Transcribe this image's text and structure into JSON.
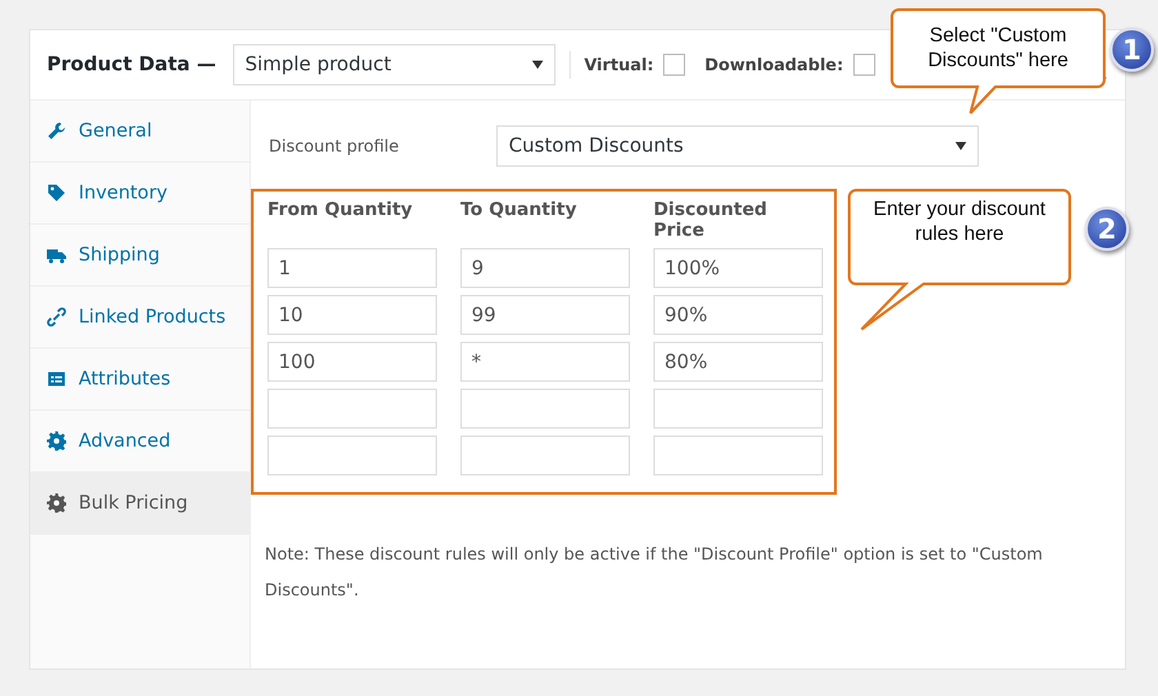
{
  "header": {
    "title": "Product Data —",
    "product_type": "Simple product",
    "options": [
      {
        "label": "Virtual:",
        "checked": false
      },
      {
        "label": "Downloadable:",
        "checked": false
      }
    ]
  },
  "sidebar": {
    "items": [
      {
        "label": "General",
        "selected": false
      },
      {
        "label": "Inventory",
        "selected": false
      },
      {
        "label": "Shipping",
        "selected": false
      },
      {
        "label": "Linked Products",
        "selected": false
      },
      {
        "label": "Attributes",
        "selected": false
      },
      {
        "label": "Advanced",
        "selected": false
      },
      {
        "label": "Bulk Pricing",
        "selected": true
      }
    ]
  },
  "discount_profile": {
    "label": "Discount profile",
    "value": "Custom Discounts"
  },
  "rules": {
    "columns": [
      "From Quantity",
      "To Quantity",
      "Discounted Price"
    ],
    "rows": [
      {
        "values": [
          "1",
          "9",
          "100%"
        ]
      },
      {
        "values": [
          "10",
          "99",
          "90%"
        ]
      },
      {
        "values": [
          "100",
          "*",
          "80%"
        ]
      },
      {},
      {}
    ]
  },
  "note": "Note: These discount rules will only be active if the \"Discount Profile\" option is set to \"Custom Discounts\".",
  "callouts": [
    {
      "number": "1",
      "text": "Select \"Custom Discounts\" here"
    },
    {
      "number": "2",
      "text": "Enter your discount rules here"
    }
  ]
}
